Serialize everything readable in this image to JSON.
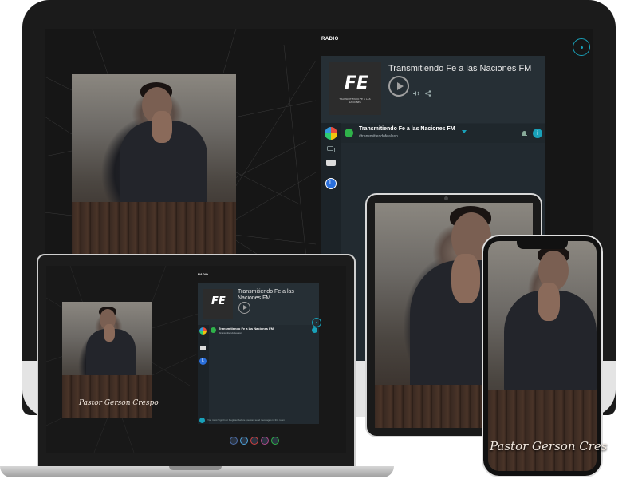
{
  "desktop": {
    "section_title": "RADIO",
    "station_name": "Transmitiendo Fe a las Naciones FM",
    "chat_title": "Transmitiendo Fe a las Naciones FM",
    "chat_hashtag": "#transmitiendofealasn"
  },
  "laptop": {
    "section_title": "RADIO",
    "station_name": "Transmitiendo Fe a las Naciones FM",
    "chat_title": "Transmitiendo Fe a las Naciones FM",
    "chat_hashtag": "#transmitiendofealasn",
    "signature": "Pastor Gerson Crespo",
    "footer_text": "You must Sign In or Register before you can send messages in this room"
  },
  "phone": {
    "signature": "Pastor Gerson Cres"
  },
  "logo": {
    "mark": "FE",
    "caption": "TRANSMITIENDO FE A LAS NACIONES"
  },
  "colors": {
    "accent": "#19a1b9",
    "chat_green": "#2fb24a",
    "background": "#161616"
  },
  "icons": {
    "play": "play-icon",
    "volume": "volume-icon",
    "share": "share-icon",
    "bell": "bell-icon",
    "info": "info-icon",
    "chat": "chat-icon",
    "user": "user-icon"
  }
}
